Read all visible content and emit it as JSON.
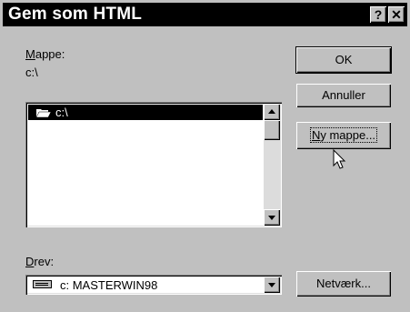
{
  "window": {
    "title": "Gem som HTML",
    "help_label": "?",
    "close_label": "✕"
  },
  "folder": {
    "label_accel": "M",
    "label_rest": "appe:",
    "current_path": "c:\\",
    "list_items": [
      {
        "label": "c:\\",
        "icon": "open-folder-icon",
        "selected": true
      }
    ]
  },
  "drive": {
    "label_accel": "D",
    "label_rest": "rev:",
    "selected": "c: MASTERWIN98",
    "icon": "hard-drive-icon"
  },
  "buttons": {
    "ok": "OK",
    "cancel": "Annuller",
    "new_folder_accel": "N",
    "new_folder_rest": "y mappe...",
    "network": "Netværk..."
  }
}
